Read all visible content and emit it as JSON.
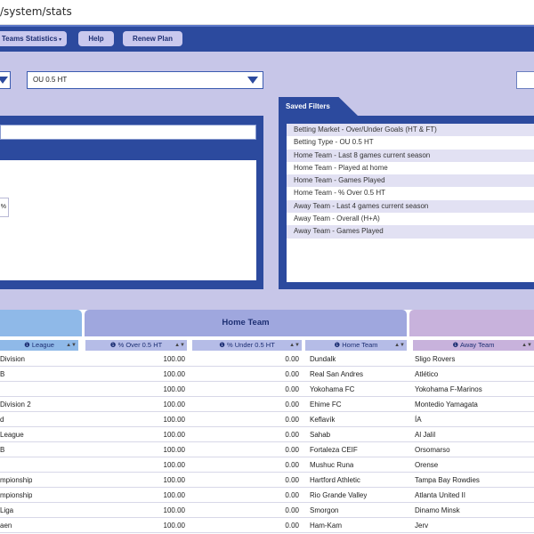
{
  "browser": {
    "url_partial": "/system/stats"
  },
  "nav": {
    "teams_statistics": "Teams Statistics",
    "help": "Help",
    "renew_plan": "Renew Plan"
  },
  "controls": {
    "market_select": "OU 0.5 HT"
  },
  "saved_filters": {
    "title": "Saved Filters",
    "items": [
      "Betting Market - Over/Under Goals (HT & FT)",
      "Betting Type - OU 0.5 HT",
      "Home Team - Last 8 games current season",
      "Home Team - Played at home",
      "Home Team - Games Played",
      "Home Team - % Over 0.5 HT",
      "Away Team - Last 4 games current season",
      "Away Team - Overall (H+A)",
      "Away Team - Games Played"
    ]
  },
  "left_input_fragment": "%",
  "table": {
    "group_headers": {
      "home_team": "Home Team"
    },
    "columns": {
      "league": "League",
      "pct_over": "% Over 0.5 HT",
      "pct_under": "% Under 0.5 HT",
      "home_team": "Home Team",
      "away_team": "Away Team"
    },
    "rows": [
      {
        "league": "Division",
        "over": "100.00",
        "under": "0.00",
        "home": "Dundalk",
        "away": "Sligo Rovers"
      },
      {
        "league": "B",
        "over": "100.00",
        "under": "0.00",
        "home": "Real San Andres",
        "away": "Atlético"
      },
      {
        "league": "",
        "over": "100.00",
        "under": "0.00",
        "home": "Yokohama FC",
        "away": "Yokohama F-Marinos"
      },
      {
        "league": "Division 2",
        "over": "100.00",
        "under": "0.00",
        "home": "Ehime FC",
        "away": "Montedio Yamagata"
      },
      {
        "league": "d",
        "over": "100.00",
        "under": "0.00",
        "home": "Keflavík",
        "away": "ÍA"
      },
      {
        "league": "League",
        "over": "100.00",
        "under": "0.00",
        "home": "Sahab",
        "away": "Al Jalil"
      },
      {
        "league": "B",
        "over": "100.00",
        "under": "0.00",
        "home": "Fortaleza CEIF",
        "away": "Orsomarso"
      },
      {
        "league": "",
        "over": "100.00",
        "under": "0.00",
        "home": "Mushuc Runa",
        "away": "Orense"
      },
      {
        "league": "mpionship",
        "over": "100.00",
        "under": "0.00",
        "home": "Hartford Athletic",
        "away": "Tampa Bay Rowdies"
      },
      {
        "league": "mpionship",
        "over": "100.00",
        "under": "0.00",
        "home": "Rio Grande Valley",
        "away": "Atlanta United II"
      },
      {
        "league": "Liga",
        "over": "100.00",
        "under": "0.00",
        "home": "Smorgon",
        "away": "Dinamo Minsk"
      },
      {
        "league": "aen",
        "over": "100.00",
        "under": "0.00",
        "home": "Ham-Kam",
        "away": "Jerv"
      }
    ]
  }
}
